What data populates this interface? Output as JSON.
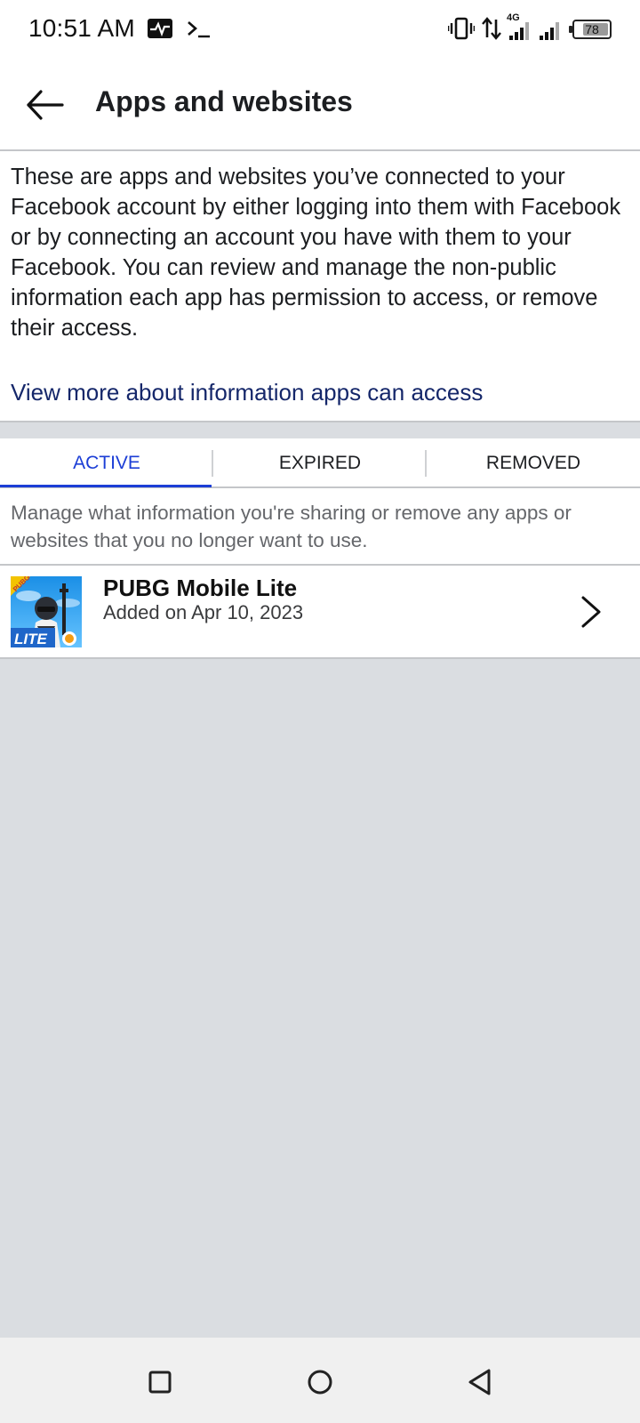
{
  "status_bar": {
    "time": "10:51 AM",
    "network_label": "4G",
    "battery_level": "78",
    "battery_percent": 78,
    "icons": [
      "activity-monitor-icon",
      "terminal-icon",
      "vibrate-icon",
      "data-transfer-icon",
      "cell-signal-icon",
      "cell-signal-icon",
      "battery-icon"
    ]
  },
  "header": {
    "title": "Apps and websites",
    "back_icon": "arrow-left-icon"
  },
  "intro": {
    "text": "These are apps and websites you’ve connected to your Facebook account by either logging into them with Facebook or by connecting an account you have with them to your Facebook. You can review and manage the non-public information each app has permission to access, or remove their access.",
    "link": "View more about information apps can access"
  },
  "tabs": [
    {
      "label": "ACTIVE",
      "selected": true
    },
    {
      "label": "EXPIRED",
      "selected": false
    },
    {
      "label": "REMOVED",
      "selected": false
    }
  ],
  "tab_description": "Manage what information you're sharing or remove any apps or websites that you no longer want to use.",
  "apps": [
    {
      "name": "PUBG Mobile Lite",
      "added": "Added on Apr 10, 2023",
      "icon_badge_top": "PUBG",
      "icon_badge_bottom": "LITE",
      "icon": "pubg-mobile-lite-app-icon",
      "chevron_icon": "chevron-right-icon"
    }
  ],
  "colors": {
    "accent": "#1c3ed6",
    "link": "#15276a",
    "background": "#dadde1",
    "divider": "#c4c6c9"
  },
  "nav_bar": {
    "icons": [
      "square-recents-icon",
      "circle-home-icon",
      "triangle-back-icon"
    ]
  }
}
